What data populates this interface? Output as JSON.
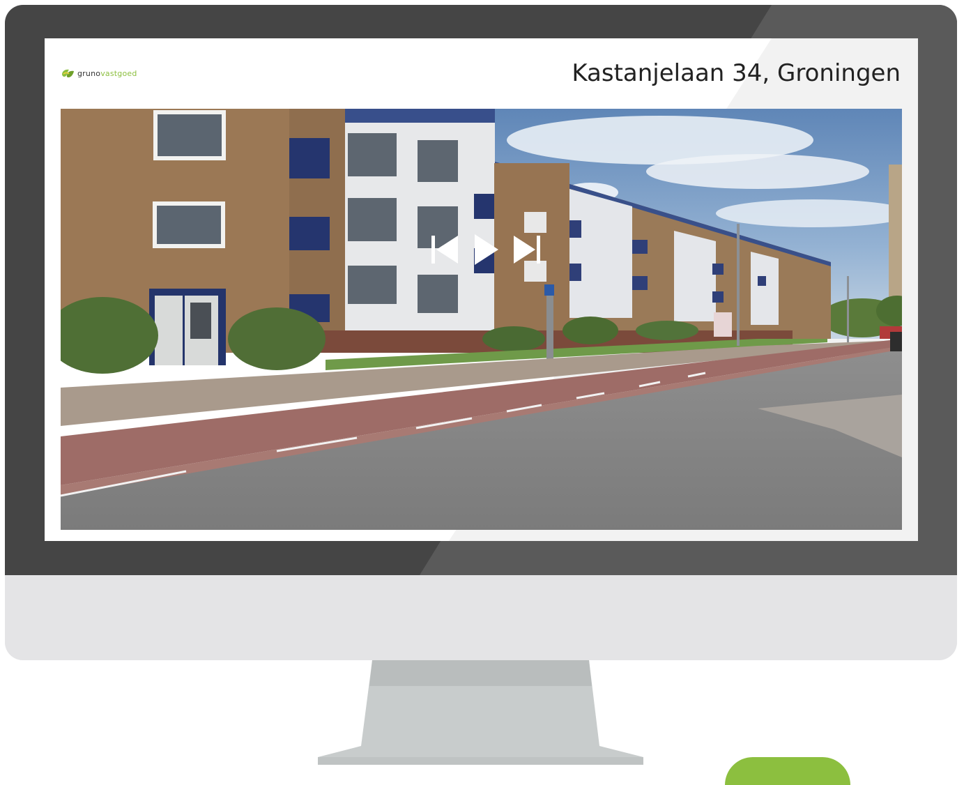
{
  "brand": {
    "name_part1": "gruno",
    "name_part2": "vastgoed",
    "color_primary": "#8cbf3f",
    "color_text": "#333333"
  },
  "listing": {
    "address": "Kastanjelaan 34, Groningen"
  },
  "slideshow": {
    "controls": [
      {
        "name": "previous",
        "icon": "skip-back-icon"
      },
      {
        "name": "play",
        "icon": "play-icon"
      },
      {
        "name": "next",
        "icon": "skip-forward-icon"
      }
    ]
  }
}
